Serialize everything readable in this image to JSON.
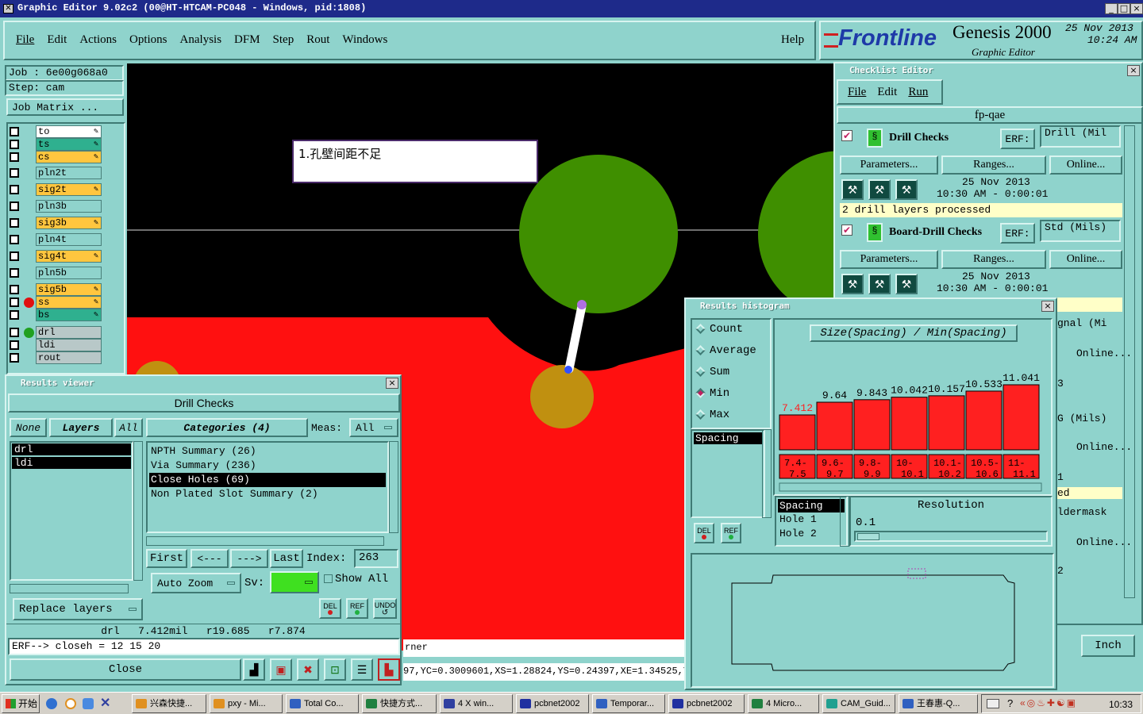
{
  "window": {
    "title": "Graphic Editor 9.02c2 (00@HT-HTCAM-PC048 - Windows, pid:1808)"
  },
  "menubar": {
    "items": [
      "File",
      "Edit",
      "Actions",
      "Options",
      "Analysis",
      "DFM",
      "Step",
      "Rout",
      "Windows"
    ],
    "help": "Help"
  },
  "brand": {
    "logo": "Frontline",
    "product": "Genesis 2000",
    "subtitle": "Graphic Editor",
    "date": "25 Nov 2013",
    "time": "10:24 AM"
  },
  "job": {
    "job": "Job : 6e00g068a0",
    "step": "Step: cam",
    "matrix_button": "Job Matrix ..."
  },
  "layers": [
    {
      "name": "to",
      "color": "#ffffff"
    },
    {
      "name": "ts",
      "color": "#2fb08f"
    },
    {
      "name": "cs",
      "color": "#ffc63f"
    },
    {
      "name": "pln2t",
      "color": "#8fd3cc"
    },
    {
      "name": "sig2t",
      "color": "#ffc63f"
    },
    {
      "name": "pln3b",
      "color": "#8fd3cc"
    },
    {
      "name": "sig3b",
      "color": "#ffc63f"
    },
    {
      "name": "pln4t",
      "color": "#8fd3cc"
    },
    {
      "name": "sig4t",
      "color": "#ffc63f"
    },
    {
      "name": "pln5b",
      "color": "#8fd3cc"
    },
    {
      "name": "sig5b",
      "color": "#ffc63f"
    },
    {
      "name": "ss",
      "color": "#ffc63f"
    },
    {
      "name": "bs",
      "color": "#2fb08f"
    },
    {
      "name": "drl",
      "color": "#b8c8c8"
    },
    {
      "name": "ldi",
      "color": "#b8c8c8"
    },
    {
      "name": "rout",
      "color": "#b8c8c8"
    }
  ],
  "canvas": {
    "annotation": "1.孔壁间距不足",
    "status_fragment": "rner",
    "coords": "97,YC=0.3009601,XS=1.28824,YS=0.24397,XE=1.34525,YE"
  },
  "results_viewer": {
    "title": "Results viewer",
    "header": "Drill Checks",
    "layer_buttons": {
      "none": "None",
      "layers": "Layers",
      "all": "All"
    },
    "layer_list": [
      "drl",
      "ldi"
    ],
    "categories_label": "Categories (4)",
    "meas_label": "Meas:",
    "meas_value": "All",
    "categories": [
      "NPTH Summary (26)",
      "Via Summary (236)",
      "Close Holes (69)",
      "Non Plated Slot Summary (2)"
    ],
    "selected_category": "Close Holes (69)",
    "nav": {
      "first": "First",
      "prev": "<---",
      "next": "--->",
      "last": "Last",
      "index_label": "Index:",
      "index_value": "263"
    },
    "zoom": "Auto Zoom",
    "sv_label": "Sv:",
    "show_all": "Show All",
    "replace": "Replace layers",
    "icons": {
      "del": "DEL",
      "ref": "REF",
      "undo": "UNDO"
    },
    "measurement": "drl   7.412mil   r19.685   r7.874",
    "erf": "ERF--> closeh = 12 15 20",
    "close": "Close"
  },
  "checklist": {
    "title": "Checklist Editor",
    "menu": [
      "File",
      "Edit",
      "Run"
    ],
    "name": "fp-qae",
    "checks": [
      {
        "name": "Drill Checks",
        "erf": "Drill (Mil",
        "date": "25 Nov 2013",
        "time": "10:30 AM - 0:00:01",
        "message": "2 drill layers processed"
      },
      {
        "name": "Board-Drill Checks",
        "erf": "Std (Mils)",
        "date": "25 Nov 2013",
        "time": "10:30 AM - 0:00:01",
        "message": ""
      }
    ],
    "buttons": {
      "params": "Parameters...",
      "ranges": "Ranges...",
      "online": "Online...",
      "erf": "ERF:"
    },
    "hidden_fragments": [
      "gnal (Mi",
      "3",
      "G (Mils)",
      "1",
      "ed",
      "ldermask",
      "2"
    ],
    "units": "Inch"
  },
  "histogram": {
    "title": "Results histogram",
    "modes": [
      "Count",
      "Average",
      "Sum",
      "Min",
      "Max"
    ],
    "selected_mode": "Min",
    "list": [
      "Spacing"
    ],
    "chart_title": "Size(Spacing) / Min(Spacing)",
    "values": [
      "7.412",
      "9.64",
      "9.843",
      "10.042",
      "10.157",
      "10.533",
      "11.041"
    ],
    "ranges": [
      "7.4-7.5",
      "9.6-9.7",
      "9.8-9.9",
      "10-10.1",
      "10.1-10.2",
      "10.5-10.6",
      "11-11.1"
    ],
    "attrs": [
      "Spacing",
      "Hole 1",
      "Hole 2"
    ],
    "resolution_label": "Resolution",
    "resolution_value": "0.1"
  },
  "chart_data": {
    "type": "bar",
    "title": "Size(Spacing) / Min(Spacing)",
    "categories": [
      "7.4-7.5",
      "9.6-9.7",
      "9.8-9.9",
      "10-10.1",
      "10.1-10.2",
      "10.5-10.6",
      "11-11.1"
    ],
    "values": [
      7.412,
      9.64,
      9.843,
      10.042,
      10.157,
      10.533,
      11.041
    ],
    "color": "#ff2020"
  },
  "taskbar": {
    "start": "开始",
    "tasks": [
      "兴森快捷...",
      "pxy - Mi...",
      "Total Co...",
      "快捷方式...",
      "4 X win...",
      "pcbnet2002",
      "Temporar...",
      "pcbnet2002",
      "4 Micro...",
      "CAM_Guid...",
      "王春惠-Q..."
    ],
    "clock": "10:33"
  },
  "colors": {
    "panel": "#8fd3cc",
    "title_active": "#1e2a8a",
    "canvas_bg": "#000000",
    "copper": "#ff1010",
    "pad": "#3f8f00",
    "drill": "#c09010"
  }
}
